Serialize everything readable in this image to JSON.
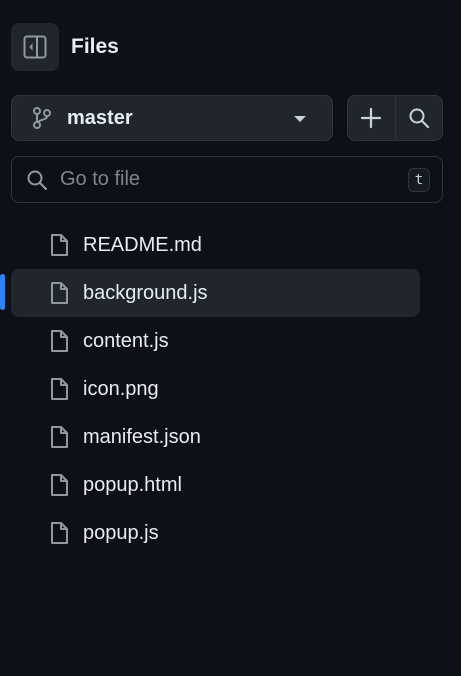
{
  "header": {
    "title": "Files",
    "toggle_icon": "sidebar-collapse-icon"
  },
  "branch": {
    "name": "master",
    "icon": "git-branch-icon"
  },
  "actions": {
    "add_icon": "plus-icon",
    "search_icon": "search-icon"
  },
  "search": {
    "placeholder": "Go to file",
    "value": "",
    "shortcut": "t"
  },
  "files": {
    "items": [
      {
        "name": "README.md",
        "selected": false
      },
      {
        "name": "background.js",
        "selected": true
      },
      {
        "name": "content.js",
        "selected": false
      },
      {
        "name": "icon.png",
        "selected": false
      },
      {
        "name": "manifest.json",
        "selected": false
      },
      {
        "name": "popup.html",
        "selected": false
      },
      {
        "name": "popup.js",
        "selected": false
      }
    ]
  },
  "colors": {
    "background": "#0d1117",
    "button_bg": "#21262d",
    "border": "#30363d",
    "text": "#e6edf3",
    "muted": "#7d8590",
    "accent": "#2f81f7"
  }
}
